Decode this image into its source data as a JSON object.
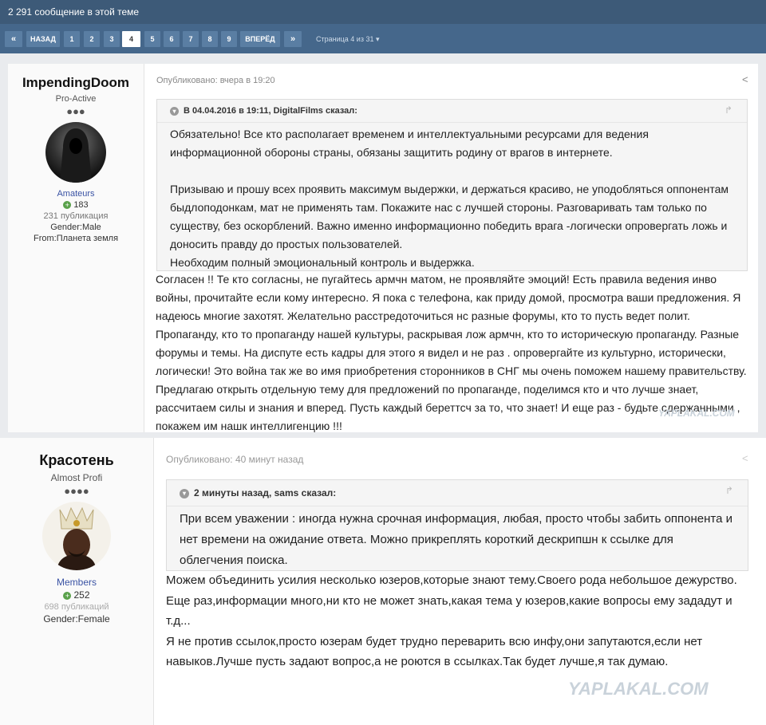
{
  "topic": {
    "post_count_text": "2 291 сообщение в этой теме"
  },
  "pagination": {
    "prev_label": "НАЗАД",
    "next_label": "ВПЕРЁД",
    "pages": [
      "1",
      "2",
      "3",
      "4",
      "5",
      "6",
      "7",
      "8",
      "9"
    ],
    "current": "4",
    "page_info": "Страница 4 из 31 ▾"
  },
  "posts": [
    {
      "author": {
        "name": "ImpendingDoom",
        "rank": "Pro-Active",
        "rank_dots": "●●●",
        "group": "Amateurs",
        "reputation": "183",
        "post_count": "231 публикация",
        "gender": "Gender:Male",
        "from": "From:Планета земля"
      },
      "published": "Опубликовано: вчера в 19:20",
      "quote": {
        "header": "В 04.04.2016 в 19:11, DigitalFilms сказал:",
        "paragraphs": [
          "Обязательно! Все кто располагает временем и интеллектуальными ресурсами для ведения информационной обороны страны, обязаны защитить родину от врагов в интернете.",
          "Призываю и прошу всех проявить максимум выдержки, и держаться красиво, не уподобляться оппонентам быдлоподонкам, мат не применять там. Покажите нас с лучшей стороны. Разговаривать там только по существу, без оскорблений. Важно именно информационно победить врага -логически опровергать ложь и доносить правду до простых пользователей.",
          "Необходим полный эмоциональный контроль и выдержка."
        ]
      },
      "body": "Согласен !! Те кто согласны, не пугайтесь армчн матом, не проявляйте эмоций! Есть правила ведения инво войны, прочитайте если кому интересно. Я пока с телефона, как приду домой, просмотра ваши предложения. Я надеюсь многие захотят. Желательно расстредоточиться нс разные форумы, кто то пусть ведет полит. Пропаганду, кто то пропаганду нашей культуры, раскрывая лож армчн, кто то историческую пропаганду. Разные форумы и темы. На диспуте есть кадры для этого я видел и не раз . опровергайте из культурно, исторически, логически! Это война так же во имя приобретения сторонников в СНГ мы очень поможем нашему правительству. Предлагаю открыть отдельную тему для предложений по пропаганде, поделимся кто и что лучше знает, рассчитаем силы и знания и вперед. Пусть каждый береттсч за то, что знает! И еще раз - будьте сдержанными , покажем им нашк интеллигенцию !!!"
    },
    {
      "author": {
        "name": "Красотень",
        "rank": "Almost Profi",
        "rank_dots": "●●●●",
        "group": "Members",
        "reputation": "252",
        "post_count": "698 публикаций",
        "gender": "Gender:Female"
      },
      "published": "Опубликовано: 40 минут назад",
      "quote": {
        "header": "2 минуты назад, sams сказал:",
        "paragraphs": [
          "При всем  уважении : иногда нужна срочная информация, любая, просто чтобы забить оппонента и нет времени на ожидание ответа. Можно прикреплять короткий дескрипшн к ссылке для облегчения поиска."
        ]
      },
      "body_lines": [
        "Можем объединить усилия несколько юзеров,которые знают тему.Своего рода небольшое дежурство.",
        "Еще раз,информации много,ни кто не может знать,какая тема у юзеров,какие вопросы ему зададут и т.д...",
        "Я не против ссылок,просто юзерам будет трудно переварить всю инфу,они запутаются,если нет навыков.Лучше пусть задают вопрос,а не роются в ссылках.Так будет лучше,я так думаю."
      ]
    }
  ],
  "watermark": "YAPLAKAL.COM",
  "colors": {
    "header_bg": "#3d5a78",
    "pager_bg": "#45678b",
    "group_link": "#3a53a4",
    "rep_positive": "#5aa14b"
  }
}
